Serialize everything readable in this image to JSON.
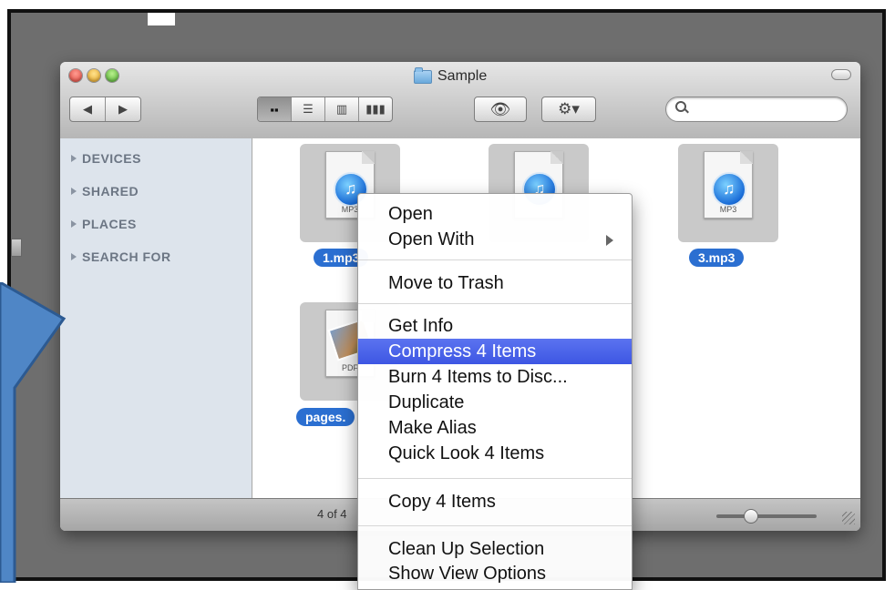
{
  "window": {
    "title": "Sample",
    "view_buttons": [
      "icon-view",
      "list-view",
      "column-view",
      "coverflow-view"
    ]
  },
  "sidebar": {
    "items": [
      {
        "label": "DEVICES"
      },
      {
        "label": "SHARED"
      },
      {
        "label": "PLACES"
      },
      {
        "label": "SEARCH FOR"
      }
    ]
  },
  "files": [
    {
      "name": "1.mp3",
      "kind": "MP3"
    },
    {
      "name": "",
      "kind": ""
    },
    {
      "name": "3.mp3",
      "kind": "MP3"
    },
    {
      "name": "pages.",
      "kind": "PDF"
    }
  ],
  "statusbar": {
    "text": "4 of 4"
  },
  "context_menu": {
    "items": [
      "Open",
      "Open With",
      "Move to Trash",
      "Get Info",
      "Compress 4 Items",
      "Burn 4 Items to Disc...",
      "Duplicate",
      "Make Alias",
      "Quick Look 4 Items",
      "Copy 4 Items",
      "Clean Up Selection",
      "Show View Options"
    ],
    "highlighted": "Compress 4 Items"
  },
  "colors": {
    "selection": "#2b6fd1",
    "menu_highlight": "#4a62e8",
    "callout": "#4f86c6"
  }
}
